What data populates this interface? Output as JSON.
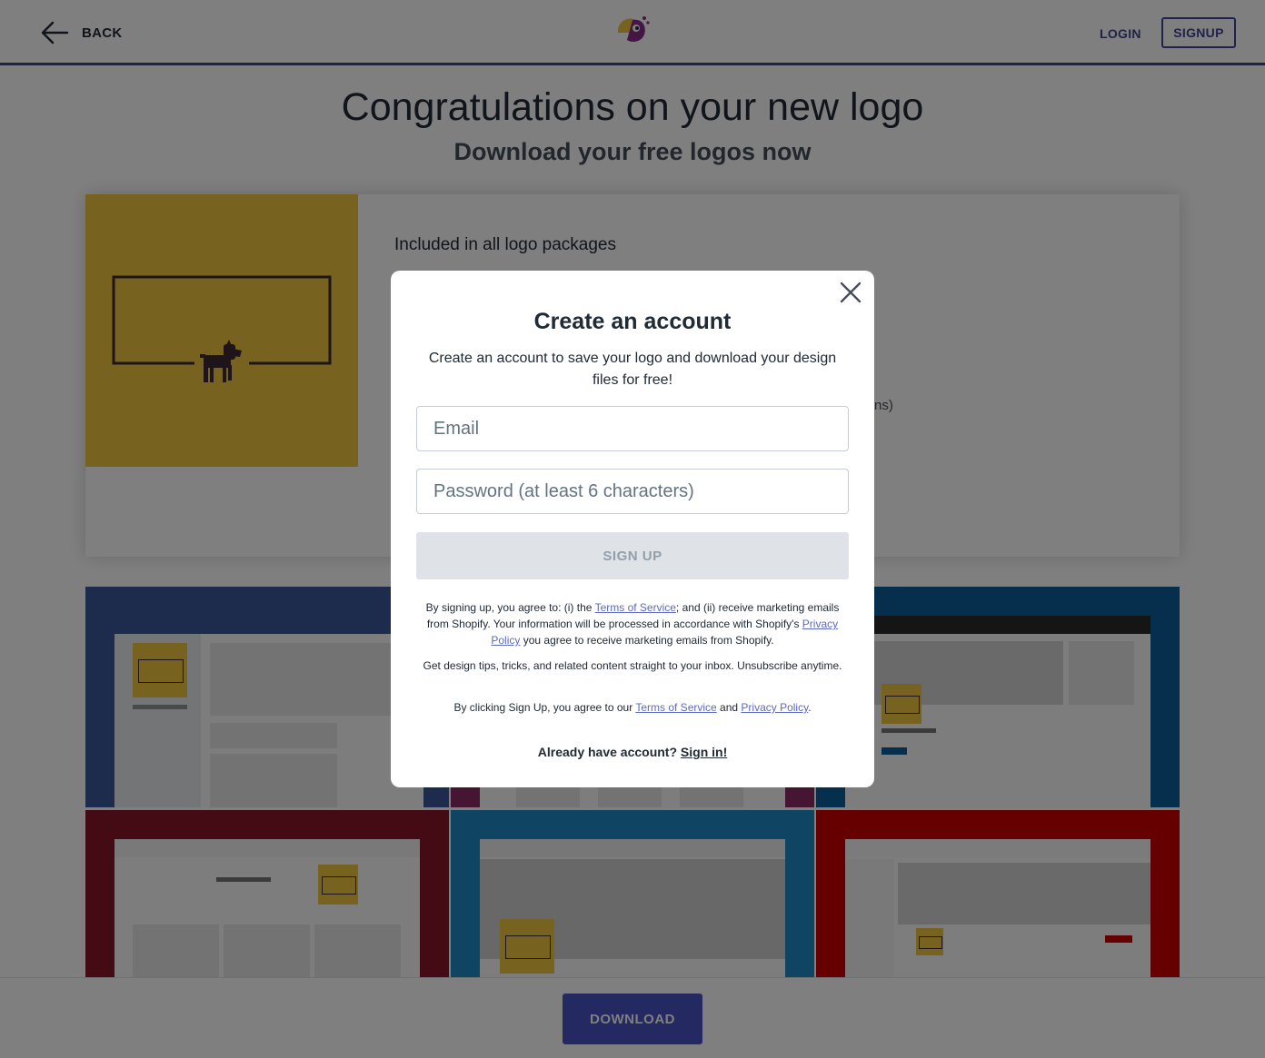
{
  "header": {
    "back_label": "BACK",
    "login_label": "LOGIN",
    "signup_label": "SIGNUP"
  },
  "page": {
    "title": "Congratulations on your new logo",
    "subtitle": "Download your free logos now"
  },
  "package": {
    "heading": "Included in all logo packages",
    "partial_text": "ns)"
  },
  "modal": {
    "title": "Create an account",
    "description": "Create an account to save your logo and download your design files for free!",
    "email_placeholder": "Email",
    "password_placeholder": "Password (at least 6 characters)",
    "signup_button": "SIGN UP",
    "legal_1_prefix": "By signing up, you agree to: (i) the ",
    "legal_1_link_tos": "Terms of Service",
    "legal_1_middle": "; and (ii) receive marketing emails from Shopify. Your information will be processed in accordance with Shopify's ",
    "legal_1_link_privacy": "Privacy Policy",
    "legal_1_suffix": " you agree to receive marketing emails from Shopify.",
    "legal_2": "Get design tips, tricks, and related content straight to your inbox. Unsubscribe anytime.",
    "legal_3_prefix": "By clicking Sign Up, you agree to our ",
    "legal_3_link_tos": "Terms of Service",
    "legal_3_and": " and ",
    "legal_3_link_privacy": "Privacy Policy",
    "legal_3_suffix": ".",
    "already_text": "Already have account? ",
    "sign_in_link": "Sign in!"
  },
  "footer": {
    "download_label": "DOWNLOAD"
  },
  "colors": {
    "accent": "#3f4494",
    "download_button": "#4a52c4",
    "logo_background": "#f0c440",
    "link": "#5c6ac4"
  },
  "icons": {
    "back": "arrow-left-icon",
    "brand": "parrot-logo-icon",
    "close": "close-icon",
    "logo_mark": "dog-icon"
  }
}
